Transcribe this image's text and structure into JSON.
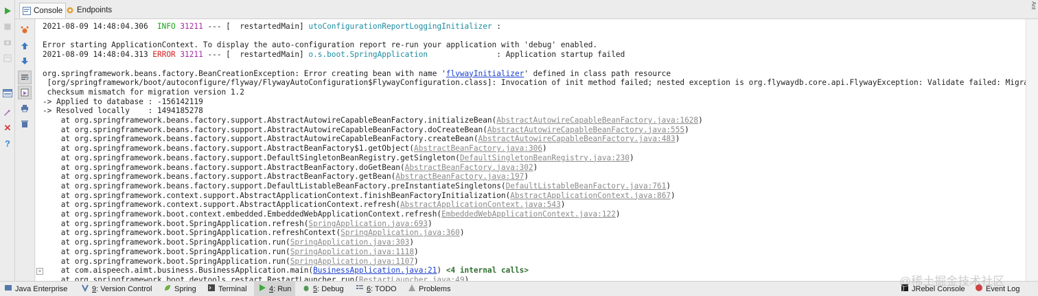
{
  "tabs": [
    {
      "label": "Console",
      "active": true,
      "icon": "console-icon"
    },
    {
      "label": "Endpoints",
      "active": false,
      "icon": "endpoints-icon"
    }
  ],
  "colors": {
    "info": "#1aa31a",
    "error": "#d01f1f",
    "pid": "#a626a4",
    "logger": "#1a8ca0",
    "link": "#1a3fcf",
    "source": "#8a8a8a"
  },
  "console": {
    "header_lines": [
      {
        "ts": "2021-08-09 14:48:04.306",
        "level": " INFO",
        "pid": "31211",
        "sep": " --- [  restartedMain] ",
        "logger": "utoConfigurationReportLoggingInitializer",
        "msg": " :"
      },
      {
        "text": ""
      },
      {
        "text": "Error starting ApplicationContext. To display the auto-configuration report re-run your application with 'debug' enabled."
      },
      {
        "ts": "2021-08-09 14:48:04.313",
        "level": "ERROR",
        "pid": "31211",
        "sep": " --- [  restartedMain] ",
        "logger": "o.s.boot.SpringApplication",
        "msg": "               : Application startup failed"
      },
      {
        "text": ""
      }
    ],
    "exception": {
      "prefix": "org.springframework.beans.factory.BeanCreationException: Error creating bean with name '",
      "bean": "flywayInitializer",
      "suffix": "' defined in class path resource",
      "line2": " [org/springframework/boot/autoconfigure/flyway/FlywayAutoConfiguration$FlywayConfiguration.class]: Invocation of init method failed; nested exception is org.flywaydb.core.api.FlywayException: Validate failed: Migration",
      "line3": " checksum mismatch for migration version 1.2",
      "line4": "-> Applied to database : -156142119",
      "line5": "-> Resolved locally    : 1494185278"
    },
    "stack": [
      {
        "method": "org.springframework.beans.factory.support.AbstractAutowireCapableBeanFactory.initializeBean",
        "src": "AbstractAutowireCapableBeanFactory.java:1628"
      },
      {
        "method": "org.springframework.beans.factory.support.AbstractAutowireCapableBeanFactory.doCreateBean",
        "src": "AbstractAutowireCapableBeanFactory.java:555"
      },
      {
        "method": "org.springframework.beans.factory.support.AbstractAutowireCapableBeanFactory.createBean",
        "src": "AbstractAutowireCapableBeanFactory.java:483"
      },
      {
        "method": "org.springframework.beans.factory.support.AbstractBeanFactory$1.getObject",
        "src": "AbstractBeanFactory.java:306"
      },
      {
        "method": "org.springframework.beans.factory.support.DefaultSingletonBeanRegistry.getSingleton",
        "src": "DefaultSingletonBeanRegistry.java:230"
      },
      {
        "method": "org.springframework.beans.factory.support.AbstractBeanFactory.doGetBean",
        "src": "AbstractBeanFactory.java:302"
      },
      {
        "method": "org.springframework.beans.factory.support.AbstractBeanFactory.getBean",
        "src": "AbstractBeanFactory.java:197"
      },
      {
        "method": "org.springframework.beans.factory.support.DefaultListableBeanFactory.preInstantiateSingletons",
        "src": "DefaultListableBeanFactory.java:761"
      },
      {
        "method": "org.springframework.context.support.AbstractApplicationContext.finishBeanFactoryInitialization",
        "src": "AbstractApplicationContext.java:867"
      },
      {
        "method": "org.springframework.context.support.AbstractApplicationContext.refresh",
        "src": "AbstractApplicationContext.java:543"
      },
      {
        "method": "org.springframework.boot.context.embedded.EmbeddedWebApplicationContext.refresh",
        "src": "EmbeddedWebApplicationContext.java:122"
      },
      {
        "method": "org.springframework.boot.SpringApplication.refresh",
        "src": "SpringApplication.java:693"
      },
      {
        "method": "org.springframework.boot.SpringApplication.refreshContext",
        "src": "SpringApplication.java:360"
      },
      {
        "method": "org.springframework.boot.SpringApplication.run",
        "src": "SpringApplication.java:303"
      },
      {
        "method": "org.springframework.boot.SpringApplication.run",
        "src": "SpringApplication.java:1118"
      },
      {
        "method": "org.springframework.boot.SpringApplication.run",
        "src": "SpringApplication.java:1107"
      },
      {
        "method": "com.aispeech.aimt.business.BusinessApplication.main",
        "src": "BusinessApplication.java:21",
        "src_link": true,
        "extra": "<4 internal calls>",
        "fold": true
      },
      {
        "method": "org.springframework.boot.devtools.restart.RestartLauncher.run",
        "src": "RestartLauncher.java:49"
      }
    ],
    "at_prefix": "    at "
  },
  "gutter_icons": [
    "rerun-icon",
    "up-arrow-icon",
    "down-arrow-icon",
    "soft-wrap-icon",
    "scroll-to-end-icon",
    "print-icon",
    "clear-icon"
  ],
  "left_icons": [
    "run-icon",
    "stop-icon",
    "camera-icon",
    "layout-icon",
    "pin-icon",
    "close-icon",
    "help-icon"
  ],
  "bottom": [
    {
      "label": "Java Enterprise",
      "icon": "java-enterprise-icon"
    },
    {
      "num": "9",
      "label": ": Version Control",
      "icon": "version-control-icon"
    },
    {
      "label": "Spring",
      "icon": "spring-icon"
    },
    {
      "label": "Terminal",
      "icon": "terminal-icon"
    },
    {
      "num": "4",
      "label": ": Run",
      "icon": "run-icon",
      "active": true
    },
    {
      "num": "5",
      "label": ": Debug",
      "icon": "debug-icon"
    },
    {
      "num": "6",
      "label": ": TODO",
      "icon": "todo-icon"
    },
    {
      "label": "Problems",
      "icon": "problems-icon"
    },
    {
      "label": "JRebel Console",
      "icon": "jrebel-icon"
    },
    {
      "label": "Event Log",
      "icon": "event-log-icon"
    }
  ],
  "watermark": "@稀土掘金技术社区",
  "side_label": "Ant"
}
